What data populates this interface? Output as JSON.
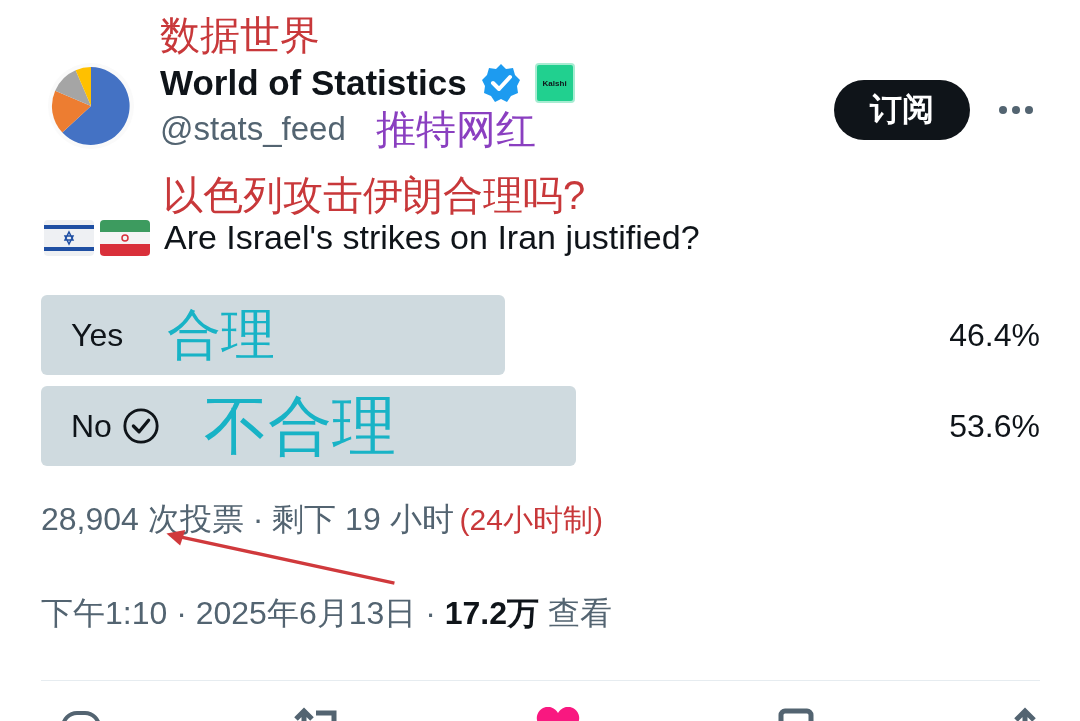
{
  "annotations": {
    "title": "数据世界",
    "account_note": "推特网红",
    "question_translation": "以色列攻击伊朗合理吗?"
  },
  "author": {
    "name": "World of Statistics",
    "verified": true,
    "badge": "Kalshi",
    "handle": "@stats_feed"
  },
  "subscribe_button": "订阅",
  "question": "Are Israel's strikes on Iran justified?",
  "poll": {
    "options": [
      {
        "label": "Yes",
        "note": "合理",
        "percent": "46.4%",
        "selected": false
      },
      {
        "label": "No",
        "note": "不合理",
        "percent": "53.6%",
        "selected": true
      }
    ],
    "summary": "28,904 次投票 · 剩下 19 小时",
    "summary_note": "(24小时制)"
  },
  "meta": "下午1:10 · 2025年6月13日 · **17.2万** 查看"
}
